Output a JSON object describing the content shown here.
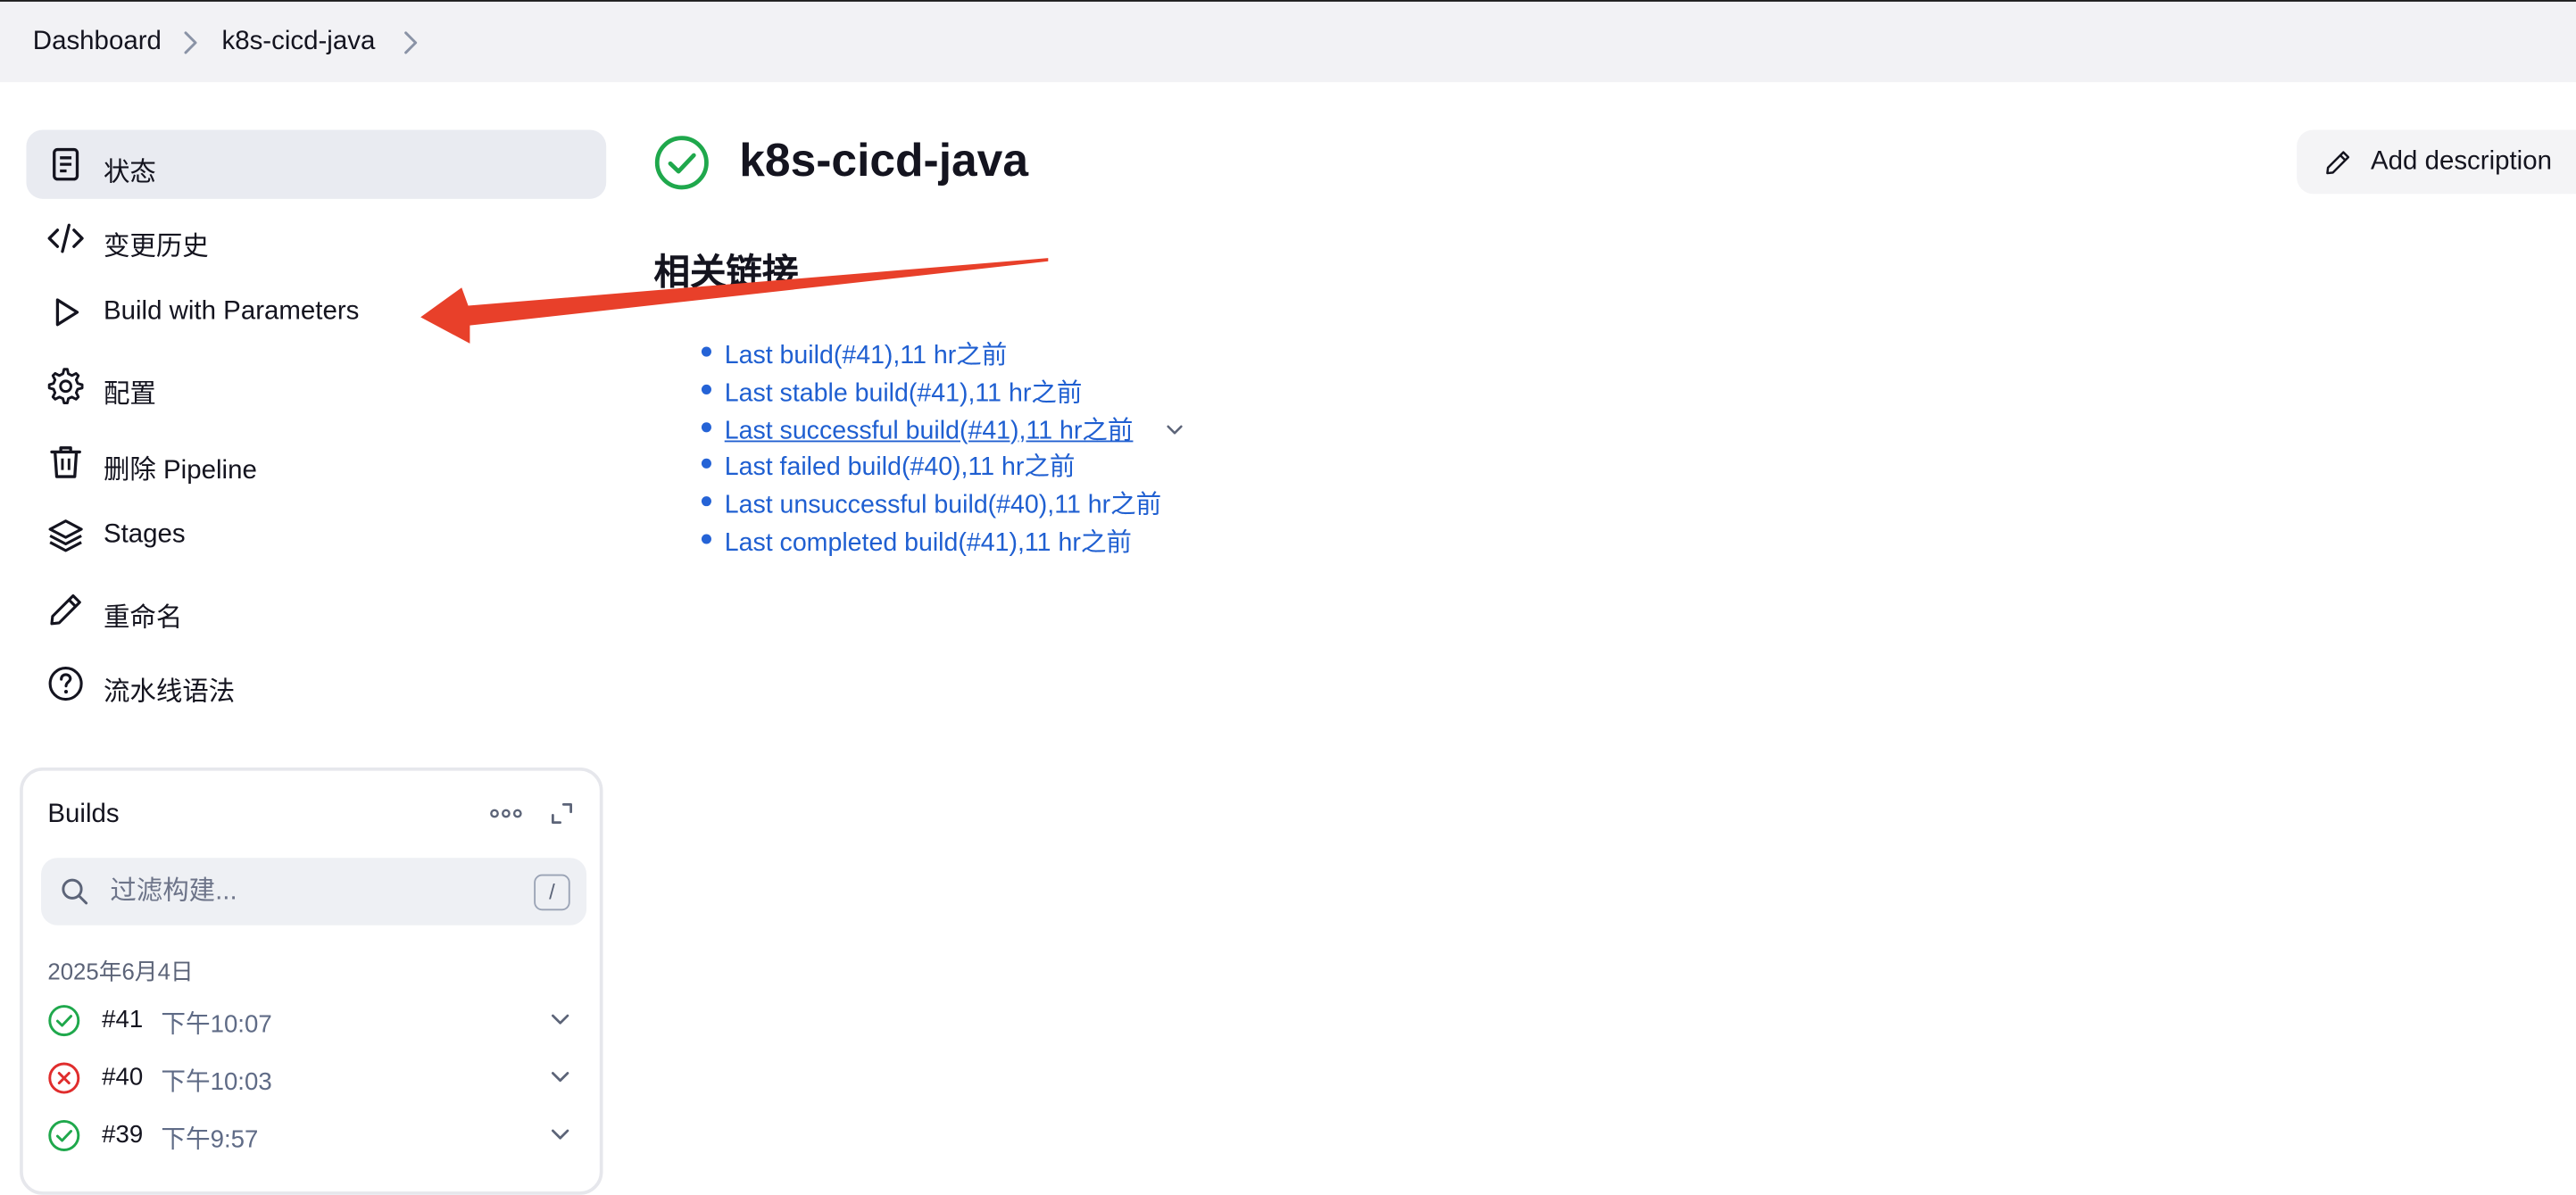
{
  "breadcrumb": {
    "items": [
      "Dashboard",
      "k8s-cicd-java"
    ]
  },
  "sidebar": {
    "items": [
      {
        "label": "状态",
        "icon": "document-icon",
        "active": true
      },
      {
        "label": "变更历史",
        "icon": "code-icon"
      },
      {
        "label": "Build with Parameters",
        "icon": "play-icon"
      },
      {
        "label": "配置",
        "icon": "gear-icon"
      },
      {
        "label": "删除 Pipeline",
        "icon": "trash-icon"
      },
      {
        "label": "Stages",
        "icon": "layers-icon"
      },
      {
        "label": "重命名",
        "icon": "pencil-icon"
      },
      {
        "label": "流水线语法",
        "icon": "help-circle-icon"
      }
    ]
  },
  "builds": {
    "title": "Builds",
    "filter_placeholder": "过滤构建...",
    "shortcut": "/",
    "date": "2025年6月4日",
    "rows": [
      {
        "number": "#41",
        "time": "下午10:07",
        "status": "success"
      },
      {
        "number": "#40",
        "time": "下午10:03",
        "status": "failed"
      },
      {
        "number": "#39",
        "time": "下午9:57",
        "status": "success"
      }
    ]
  },
  "main": {
    "title": "k8s-cicd-java",
    "section_title": "相关链接",
    "add_description": "Add description",
    "links": [
      "Last build(#41),11 hr之前",
      "Last stable build(#41),11 hr之前",
      "Last successful build(#41),11 hr之前",
      "Last failed build(#40),11 hr之前",
      "Last unsuccessful build(#40),11 hr之前",
      "Last completed build(#41),11 hr之前"
    ]
  },
  "colors": {
    "link": "#1f5fd1",
    "success": "#1fa84c",
    "failure": "#e02d2d",
    "annotation_arrow": "#e8402a",
    "active_bg": "#e9ebf1"
  }
}
